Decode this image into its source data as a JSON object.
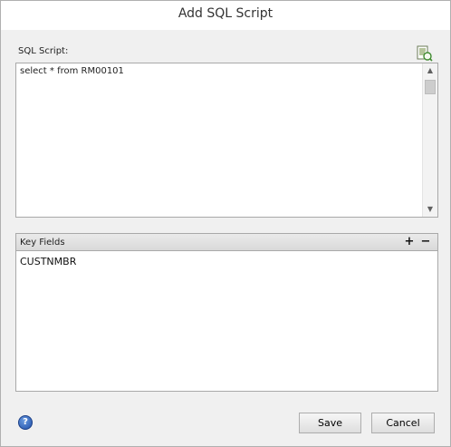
{
  "window": {
    "title": "Add SQL Script"
  },
  "sql": {
    "label": "SQL Script:",
    "text": "select * from RM00101",
    "scroll_up": "▲",
    "scroll_down": "▼",
    "icon": "sql-edit-icon"
  },
  "key_fields": {
    "header": "Key Fields",
    "add_label": "+",
    "remove_label": "−",
    "items": [
      "CUSTNMBR"
    ]
  },
  "footer": {
    "help_icon": "help-icon",
    "help_glyph": "?",
    "save_label": "Save",
    "cancel_label": "Cancel"
  },
  "colors": {
    "window_bg": "#f0f0f0",
    "header_bg": "#d9d9d9",
    "border": "#a9a9a9",
    "help_blue": "#1f4fa8"
  }
}
